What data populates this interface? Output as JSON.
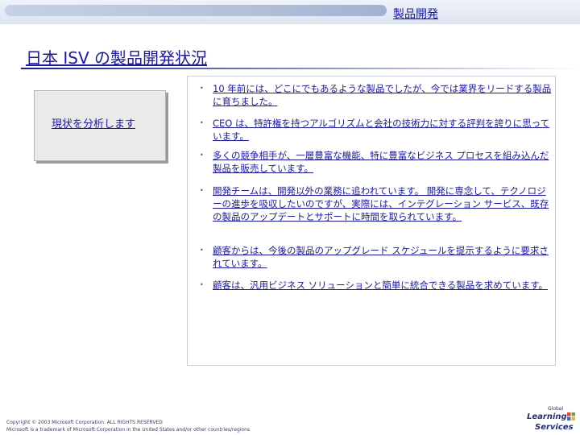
{
  "header": {
    "section_label": "製品開発"
  },
  "page": {
    "title": "日本 ISV の製品開発状況"
  },
  "analysis_box": {
    "label": "現状を分析します"
  },
  "bullets": [
    "10 年前には、どこにでもあるような製品でしたが、今では業界をリードする製品に育ちました。",
    "CEO は、特許権を持つアルゴリズムと会社の技術力に対する評判を誇りに思っています。",
    "多くの競争相手が、一層豊富な機能、特に豊富なビジネス プロセスを組み込んだ製品を販売しています。",
    "開発チームは、開発以外の業務に追われています。 開発に専念して、テクノロジーの進歩を吸収したいのですが、実際には、インテグレーション サービス、既存の製品のアップデートとサポートに時間を取られています。",
    "顧客からは、今後の製品のアップグレード スケジュールを提示するように要求されています。",
    "顧客は、汎用ビジネス ソリューションと簡単に統合できる製品を求めています。"
  ],
  "footer": {
    "copyright_line1": "Copyright © 2003 Microsoft Corporation. ALL RIGHTS RESERVED",
    "copyright_line2": "Microsoft is a trademark of Microsoft Corporation in the United States and/or other countries/regions"
  },
  "logo": {
    "line1": "Global",
    "line2": "Learning",
    "line3": "Services"
  },
  "colors": {
    "text_accent": "#1a1aa6",
    "panel_border": "#c8ccd6",
    "box_fill": "#eaeaea"
  }
}
